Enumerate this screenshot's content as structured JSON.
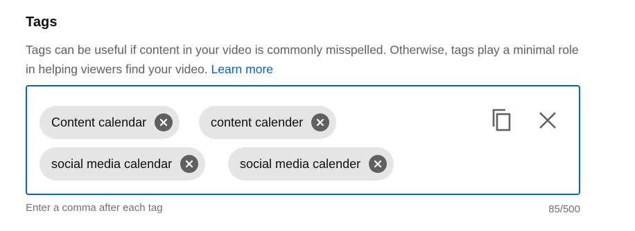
{
  "tags_section": {
    "title": "Tags",
    "description": "Tags can be useful if content in your video is commonly misspelled. Otherwise, tags play a minimal role in helping viewers find your video.",
    "learn_more": "Learn more",
    "tags": [
      {
        "label": "Content calendar"
      },
      {
        "label": "content calender"
      },
      {
        "label": "social media calendar"
      },
      {
        "label": "social media calender"
      }
    ],
    "helper_text": "Enter a comma after each tag",
    "counter": "85/500"
  },
  "icons": {
    "chip_remove": "remove-tag-icon",
    "copy": "copy-icon",
    "clear": "clear-all-icon"
  },
  "colors": {
    "accent": "#065fd4",
    "chip_bg": "#e5e5e5",
    "remove_icon_bg": "#606060",
    "secondary_text": "#606060"
  }
}
